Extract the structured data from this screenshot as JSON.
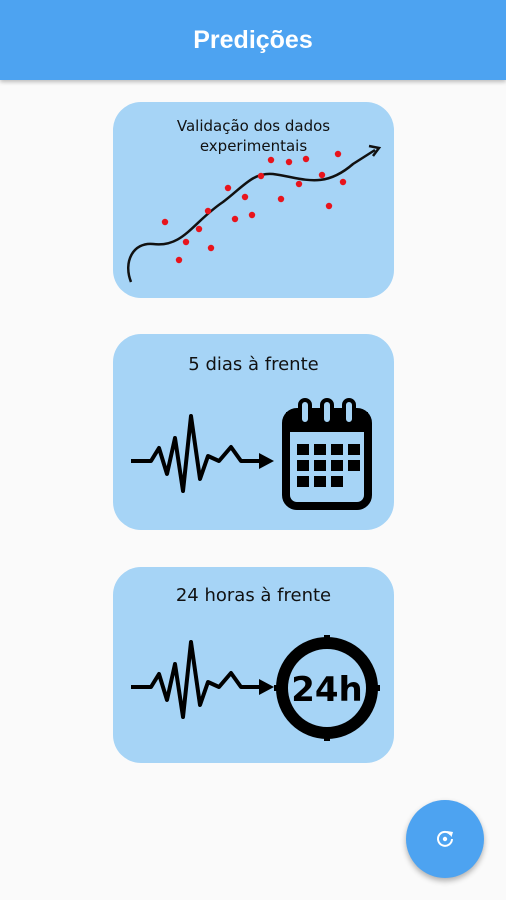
{
  "appbar": {
    "title": "Predições"
  },
  "cards": [
    {
      "label_line1": "Validação dos dados",
      "label_line2": "experimentais"
    },
    {
      "label": "5 dias à frente"
    },
    {
      "label": "24 horas à frente",
      "clock_text": "24h"
    }
  ],
  "fab": {
    "icon": "refresh-icon"
  },
  "colors": {
    "appbar": "#4da3f1",
    "card": "#a6d4f6",
    "points": "#e8141c",
    "background": "#fafafa"
  }
}
